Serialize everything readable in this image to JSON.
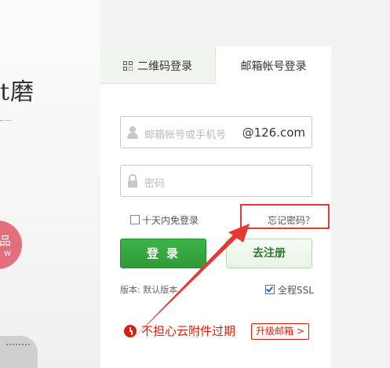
{
  "promo": {
    "title": "t磨",
    "badge_line1": "品",
    "badge_line2": "W"
  },
  "tabs": {
    "qr_label": "二维码登录",
    "mail_label": "邮箱帐号登录"
  },
  "form": {
    "username_placeholder": "邮箱帐号或手机号",
    "domain_suffix": "@126.com",
    "password_placeholder": "密码",
    "remember_label": "十天内免登录",
    "forgot_label": "忘记密码？",
    "login_label": "登录",
    "register_label": "去注册",
    "version_label": "版本: 默认版本",
    "ssl_label": "全程SSL",
    "ssl_checked": true
  },
  "promo_bar": {
    "text": "不担心云附件过期",
    "upgrade_label": "升级邮箱"
  },
  "annotation": {
    "color": "#e53935"
  }
}
